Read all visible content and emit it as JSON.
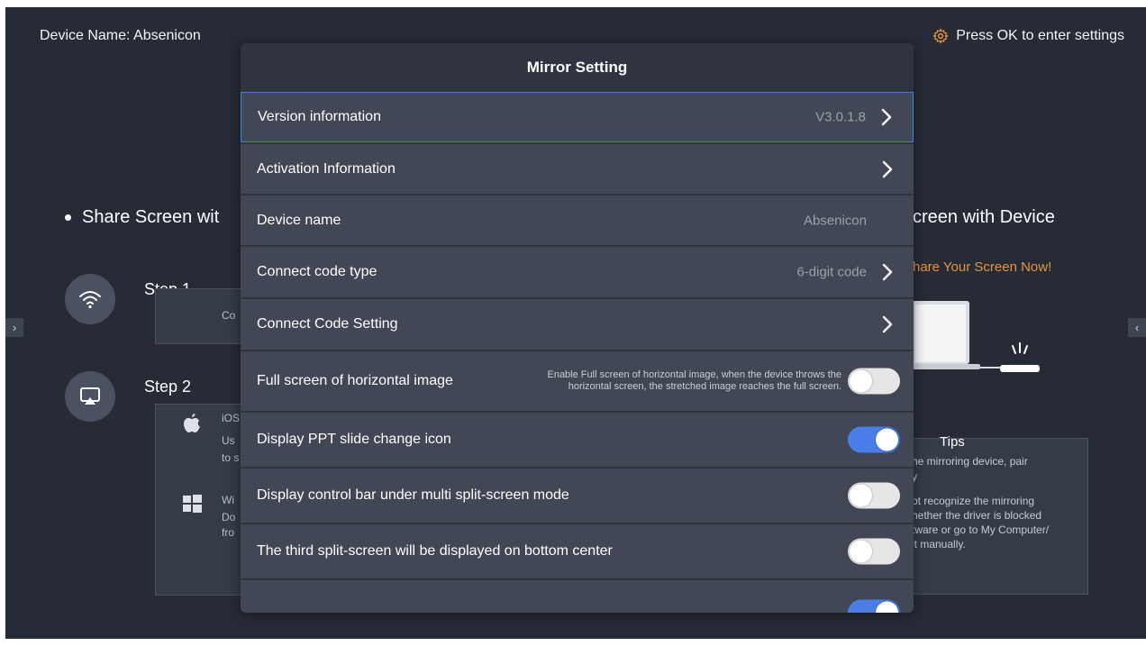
{
  "header": {
    "device_name": "Device Name: Absenicon",
    "settings_hint": "Press OK to enter settings"
  },
  "background": {
    "share_title_left": "Share Screen wit",
    "share_title_right": "creen with Device",
    "share_now": "hare Your Screen Now!",
    "step1": {
      "label": "Step  1",
      "box_text": "Co"
    },
    "step2": {
      "label": "Step  2",
      "ios_lines": [
        "iOS",
        "Us",
        "to s"
      ],
      "win_lines": [
        "Wi",
        "Do",
        "fro"
      ]
    },
    "tips": {
      "title": "Tips",
      "lines": [
        "he mirroring device, pair",
        "y",
        "ot recognize the mirroring",
        "hether the driver is blocked",
        "tware or go to My Computer/",
        "it manually."
      ]
    },
    "side_left_arrow": "›",
    "side_right_arrow": "‹"
  },
  "dialog": {
    "title": "Mirror Setting",
    "rows": [
      {
        "label": "Version information",
        "value": "V3.0.1.8"
      },
      {
        "label": "Activation Information"
      },
      {
        "label": "Device name",
        "value": "Absenicon"
      },
      {
        "label": "Connect code type",
        "value": "6-digit code"
      },
      {
        "label": "Connect Code Setting"
      },
      {
        "label": "Full screen of horizontal image",
        "description_line1": "Enable Full screen of horizontal image, when the device throws the",
        "description_line2": "horizontal screen, the stretched image reaches the full screen.",
        "toggle": false
      },
      {
        "label": "Display PPT slide change icon",
        "toggle": true
      },
      {
        "label": "Display control bar under multi split-screen mode",
        "toggle": false
      },
      {
        "label": "The third split-screen will be displayed on bottom center",
        "toggle": false
      },
      {
        "label": "",
        "toggle": true
      }
    ]
  },
  "colors": {
    "accent": "#4a7de8",
    "orange": "#e8933a",
    "focus_border": "#3d7fe0"
  },
  "icons": [
    "gear-icon",
    "wifi-icon",
    "airplay-icon",
    "apple-icon",
    "windows-icon",
    "chevron-right-icon",
    "laptop-icon"
  ]
}
